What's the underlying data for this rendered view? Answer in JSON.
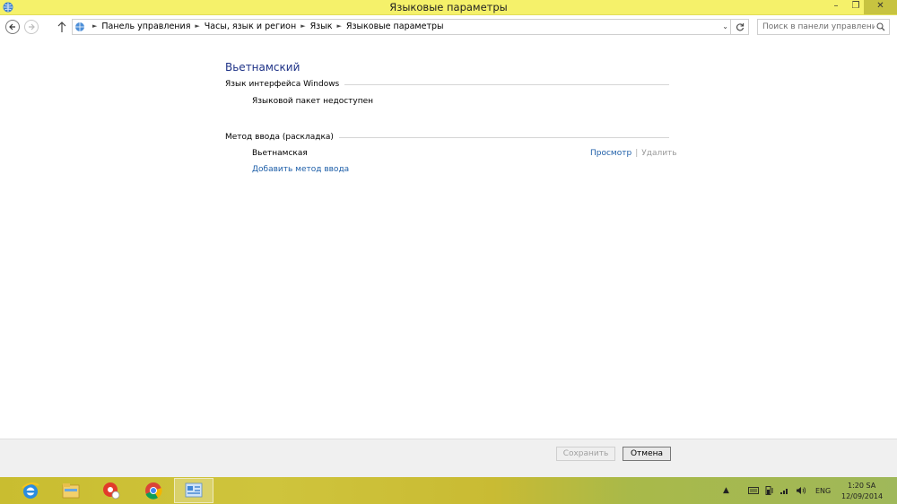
{
  "window": {
    "title": "Языковые параметры",
    "icon": "control-panel-language-icon",
    "controls": {
      "minimize": "minimize-icon",
      "maximize": "maximize-icon",
      "close": "close-icon"
    }
  },
  "navigation": {
    "back_icon": "back-arrow-icon",
    "forward_icon": "forward-arrow-icon",
    "up_icon": "up-arrow-icon",
    "breadcrumb": [
      "Панель управления",
      "Часы, язык и регион",
      "Язык",
      "Языковые параметры"
    ],
    "search_placeholder": "Поиск в панели управления"
  },
  "content": {
    "language_name": "Вьетнамский",
    "ui_language_section": "Язык интерфейса Windows",
    "ui_language_status": "Языковой пакет недоступен",
    "input_method_section": "Метод ввода (раскладка)",
    "input_method_name": "Вьетнамская",
    "preview_link": "Просмотр",
    "separator": "|",
    "remove_link": "Удалить",
    "add_input_link": "Добавить метод ввода"
  },
  "buttons": {
    "save": "Сохранить",
    "cancel": "Отмена"
  },
  "taskbar": {
    "apps": [
      "internet-explorer-icon",
      "file-explorer-icon",
      "media-player-icon",
      "chrome-icon",
      "control-panel-icon"
    ],
    "tray": {
      "language": "ENG",
      "time": "1:20 SA",
      "date": "12/09/2014"
    }
  },
  "colors": {
    "titlebar": "#f5f16a",
    "link": "#1d5ea8",
    "heading": "#1e3287"
  }
}
